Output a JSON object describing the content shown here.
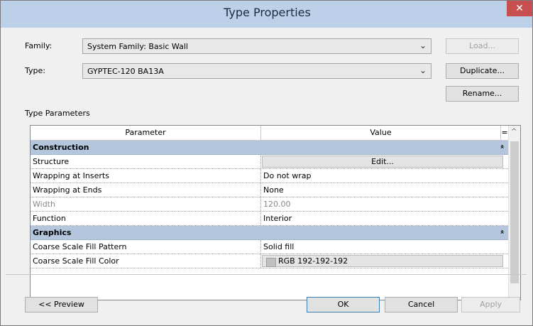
{
  "window": {
    "title": "Type Properties",
    "close_glyph": "✕"
  },
  "family": {
    "label": "Family:",
    "value": "System Family: Basic Wall"
  },
  "type": {
    "label": "Type:",
    "value": "GYPTEC-120 BA13A"
  },
  "buttons": {
    "load": "Load...",
    "duplicate": "Duplicate...",
    "rename": "Rename...",
    "preview": "<< Preview",
    "ok": "OK",
    "cancel": "Cancel",
    "apply": "Apply"
  },
  "section_label": "Type Parameters",
  "grid": {
    "col_parameter": "Parameter",
    "col_value": "Value",
    "col_equals": "=",
    "groups": [
      {
        "name": "Construction",
        "collapse_glyph": "»",
        "rows": [
          {
            "param": "Structure",
            "value": "Edit..."
          },
          {
            "param": "Wrapping at Inserts",
            "value": "Do not wrap"
          },
          {
            "param": "Wrapping at Ends",
            "value": "None"
          },
          {
            "param": "Width",
            "value": "120.00"
          },
          {
            "param": "Function",
            "value": "Interior"
          }
        ]
      },
      {
        "name": "Graphics",
        "collapse_glyph": "»",
        "rows": [
          {
            "param": "Coarse Scale Fill Pattern",
            "value": "Solid fill"
          },
          {
            "param": "Coarse Scale Fill Color",
            "value": "RGB 192-192-192",
            "swatch": "#c0c0c0"
          }
        ]
      }
    ]
  },
  "colors": {
    "title_bar": "#bcd0ea",
    "close_button": "#c74f4f",
    "group_row": "#b3c6de"
  }
}
